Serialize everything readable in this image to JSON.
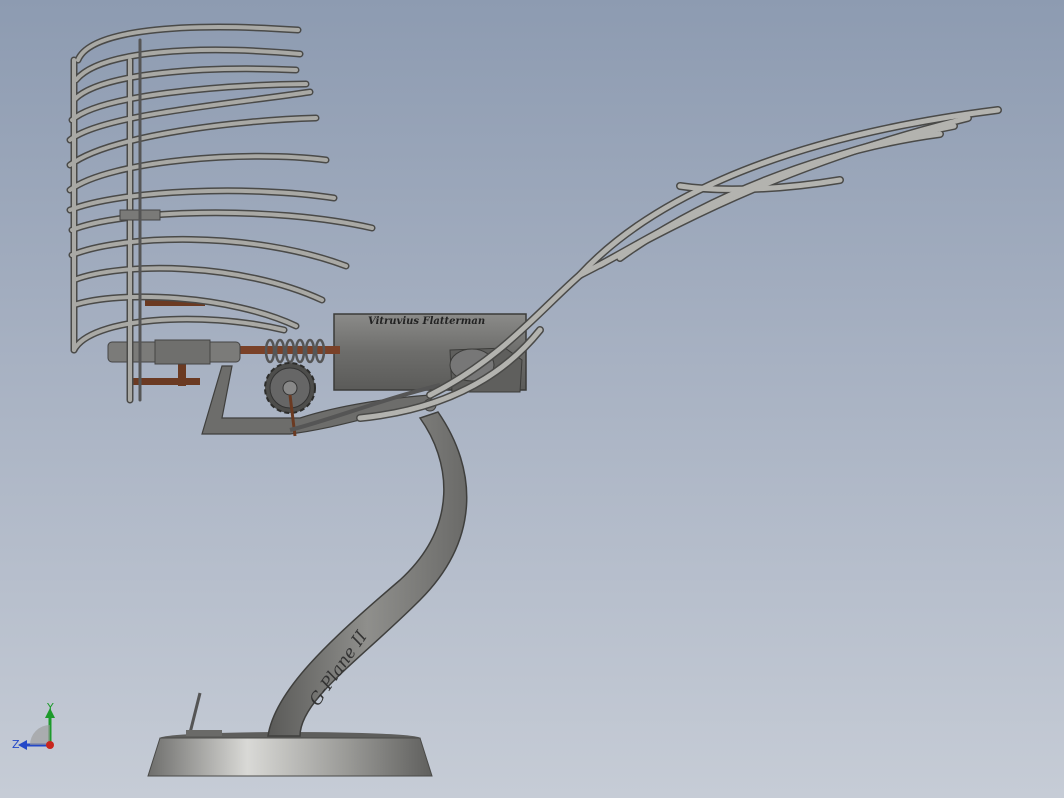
{
  "viewport": {
    "background_top": "#8d9bb1",
    "background_bottom": "#c6ccd6"
  },
  "model": {
    "housing_engraving": "Vitruvius Flatterman",
    "stand_engraving": "G-Plane II",
    "tube_color": "#8a8a86",
    "tube_highlight": "#c9c9c4",
    "rod_color": "#6b3a22",
    "housing_color": "#6f6f6d",
    "base_color": "#8c8c8a"
  },
  "triad": {
    "y_label": "Y",
    "z_label": "Z",
    "y_axis_color": "#1d9a2b",
    "z_axis_color": "#2348c8",
    "origin_color": "#c8261e"
  }
}
